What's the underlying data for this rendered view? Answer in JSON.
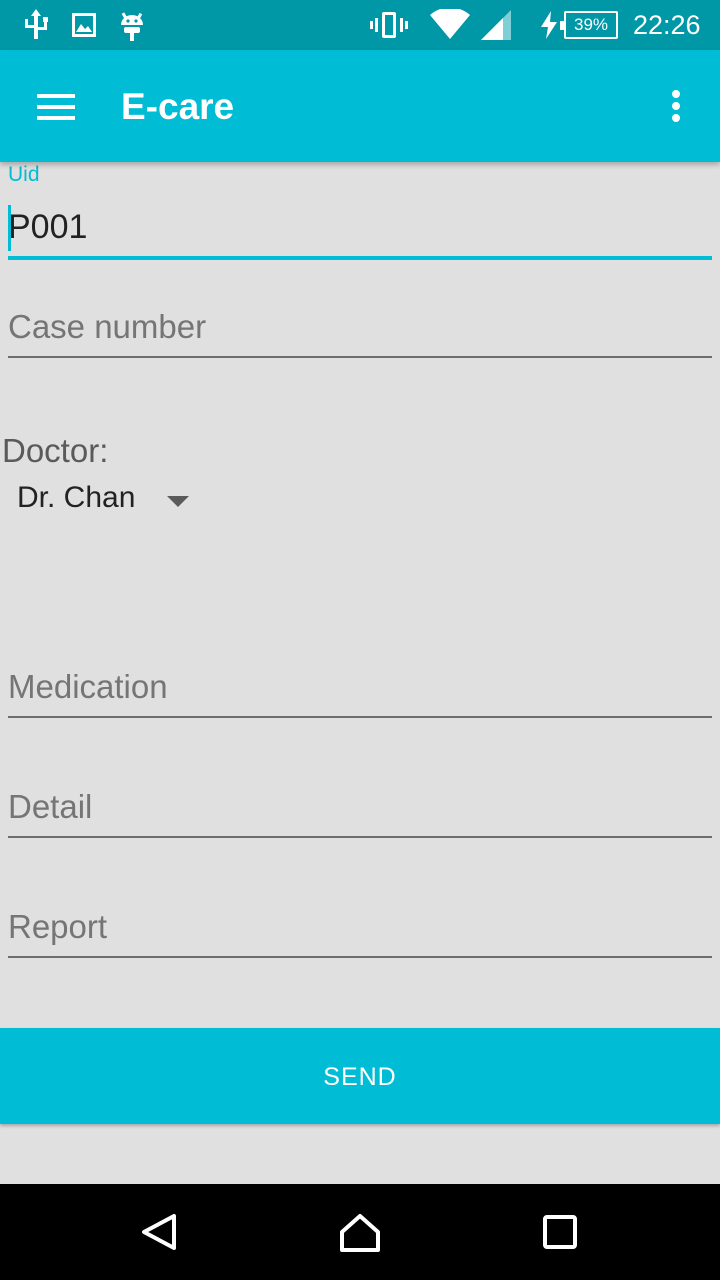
{
  "status_bar": {
    "icons": [
      "usb-icon",
      "image-icon",
      "android-icon",
      "vibrate-icon",
      "wifi-icon",
      "signal-icon",
      "charging-icon"
    ],
    "battery": "39%",
    "time": "22:26"
  },
  "app_bar": {
    "title": "E-care",
    "menu_icon": "hamburger-menu-icon",
    "overflow_icon": "more-vert-icon"
  },
  "form": {
    "uid": {
      "label": "Uid",
      "value": "P001"
    },
    "case_number": {
      "placeholder": "Case number"
    },
    "doctor": {
      "label": "Doctor:",
      "selected": "Dr. Chan"
    },
    "medication": {
      "placeholder": "Medication"
    },
    "detail": {
      "placeholder": "Detail"
    },
    "report": {
      "placeholder": "Report"
    },
    "send_label": "SEND"
  },
  "nav_bar": {
    "back_icon": "back-icon",
    "home_icon": "home-icon",
    "recents_icon": "recents-icon"
  },
  "colors": {
    "status_bar": "#0097a7",
    "accent": "#00bcd4",
    "background": "#e0e0e0"
  }
}
